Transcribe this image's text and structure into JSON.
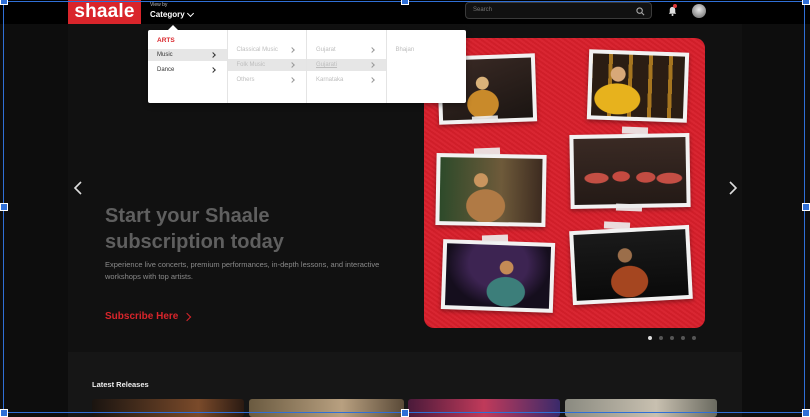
{
  "header": {
    "logo": "shaale",
    "view_by_label": "View by",
    "category_label": "Category",
    "search_placeholder": "Search"
  },
  "dropdown": {
    "columns": [
      {
        "heading": "ARTS",
        "items": [
          {
            "label": "Music",
            "active": true,
            "has_arrow": true
          },
          {
            "label": "Dance",
            "active": false,
            "has_arrow": true
          }
        ]
      },
      {
        "heading": "",
        "items": [
          {
            "label": "Classical Music",
            "active": false,
            "has_arrow": true
          },
          {
            "label": "Folk Music",
            "active": true,
            "has_arrow": true
          },
          {
            "label": "Others",
            "active": false,
            "has_arrow": true
          }
        ]
      },
      {
        "heading": "",
        "items": [
          {
            "label": "Gujarat",
            "active": false,
            "has_arrow": true
          },
          {
            "label": "Gujarati",
            "active": true,
            "has_arrow": true
          },
          {
            "label": "Karnataka",
            "active": false,
            "has_arrow": true
          }
        ]
      },
      {
        "heading": "",
        "items": [
          {
            "label": "Bhajan",
            "active": false,
            "has_arrow": false
          }
        ]
      }
    ]
  },
  "hero": {
    "title": "Start your Shaale subscription today",
    "subtitle": "Experience live concerts, premium performances, in-depth lessons, and interactive workshops with top artists.",
    "cta": "Subscribe Here",
    "slide_count": 5,
    "active_slide": 0
  },
  "latest": {
    "title": "Latest Releases"
  },
  "colors": {
    "brand_red": "#d9252b",
    "background": "#0d0d0d"
  },
  "icons": [
    "search-icon",
    "bell-icon",
    "chevron-left-icon",
    "chevron-right-icon",
    "chevron-down-icon"
  ]
}
